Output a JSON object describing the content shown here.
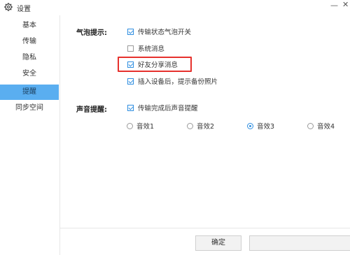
{
  "window": {
    "title": "设置",
    "minimize_symbol": "—",
    "close_symbol": "✕"
  },
  "sidebar": {
    "items": [
      {
        "label": "基本",
        "active": false
      },
      {
        "label": "传输",
        "active": false
      },
      {
        "label": "隐私",
        "active": false
      },
      {
        "label": "安全",
        "active": false
      },
      {
        "label": "提醒",
        "active": true
      },
      {
        "label": "同步空间",
        "active": false
      }
    ]
  },
  "bubble": {
    "label": "气泡提示:",
    "options": [
      {
        "label": "传输状态气泡开关",
        "checked": true
      },
      {
        "label": "系统消息",
        "checked": false
      },
      {
        "label": "好友分享消息",
        "checked": true
      },
      {
        "label": "插入设备后，提示备份照片",
        "checked": true
      }
    ]
  },
  "sound": {
    "label": "声音提醒:",
    "option": {
      "label": "传输完成后声音提醒",
      "checked": true
    },
    "effects": [
      {
        "label": "音效1",
        "selected": false
      },
      {
        "label": "音效2",
        "selected": false
      },
      {
        "label": "音效3",
        "selected": true
      },
      {
        "label": "音效4",
        "selected": false
      }
    ]
  },
  "footer": {
    "confirm_label": "确定",
    "second_label": ""
  },
  "colors": {
    "accent": "#2f8ee0",
    "sidebar_active": "#5aaef0",
    "highlight": "#e6312d"
  }
}
